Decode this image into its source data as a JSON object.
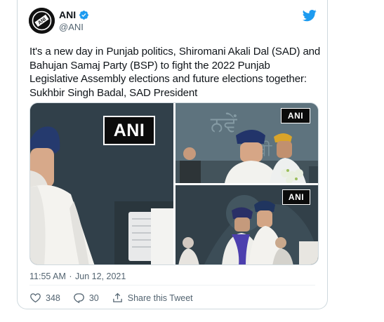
{
  "tweet": {
    "author_name": "ANI",
    "author_handle": "@ANI",
    "avatar_text": "ANI",
    "text": "It's a new day in Punjab politics, Shiromani Akali Dal (SAD) and Bahujan Samaj Party (BSP) to fight the 2022 Punjab Legislative Assembly elections and future elections together: Sukhbir Singh Badal, SAD President",
    "time": "11:55 AM",
    "date": "Jun 12, 2021",
    "separator": "·"
  },
  "media": {
    "watermark": "ANI"
  },
  "actions": {
    "likes": "348",
    "replies": "30",
    "share_label": "Share this Tweet"
  },
  "colors": {
    "brand_blue": "#1d9bf0",
    "text_primary": "#0f1419",
    "text_secondary": "#536471",
    "border": "#cfd9de"
  }
}
